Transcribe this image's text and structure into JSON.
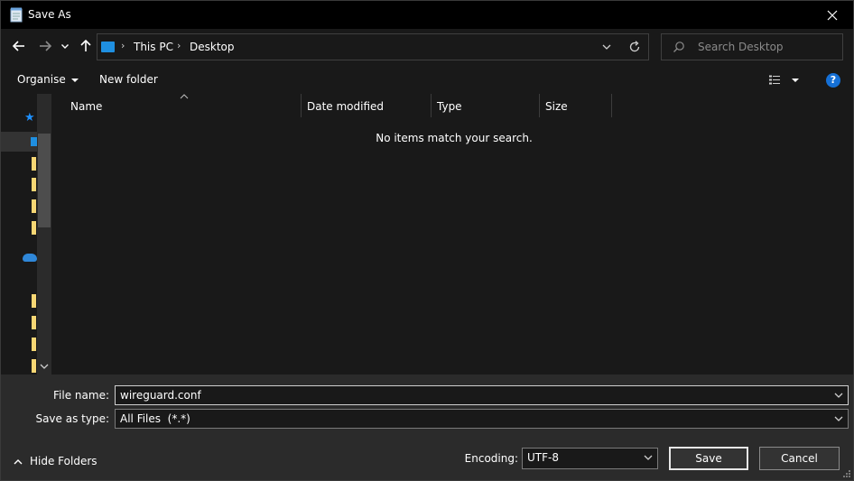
{
  "window": {
    "title": "Save As"
  },
  "address": {
    "crumbs": [
      "This PC",
      "Desktop"
    ]
  },
  "search": {
    "placeholder": "Search Desktop"
  },
  "toolbar": {
    "organise": "Organise",
    "new_folder": "New folder"
  },
  "columns": [
    "Name",
    "Date modified",
    "Type",
    "Size"
  ],
  "empty_message": "No items match your search.",
  "form": {
    "file_name_label": "File name:",
    "file_name_value": "wireguard.conf",
    "save_type_label": "Save as type:",
    "save_type_value": "All Files  (*.*)",
    "encoding_label": "Encoding:",
    "encoding_value": "UTF-8"
  },
  "buttons": {
    "hide_folders": "Hide Folders",
    "save": "Save",
    "cancel": "Cancel"
  },
  "colors": {
    "accent": "#1f8fe0",
    "folder": "#f7d774",
    "background": "#191919",
    "panel": "#2b2b2b"
  }
}
